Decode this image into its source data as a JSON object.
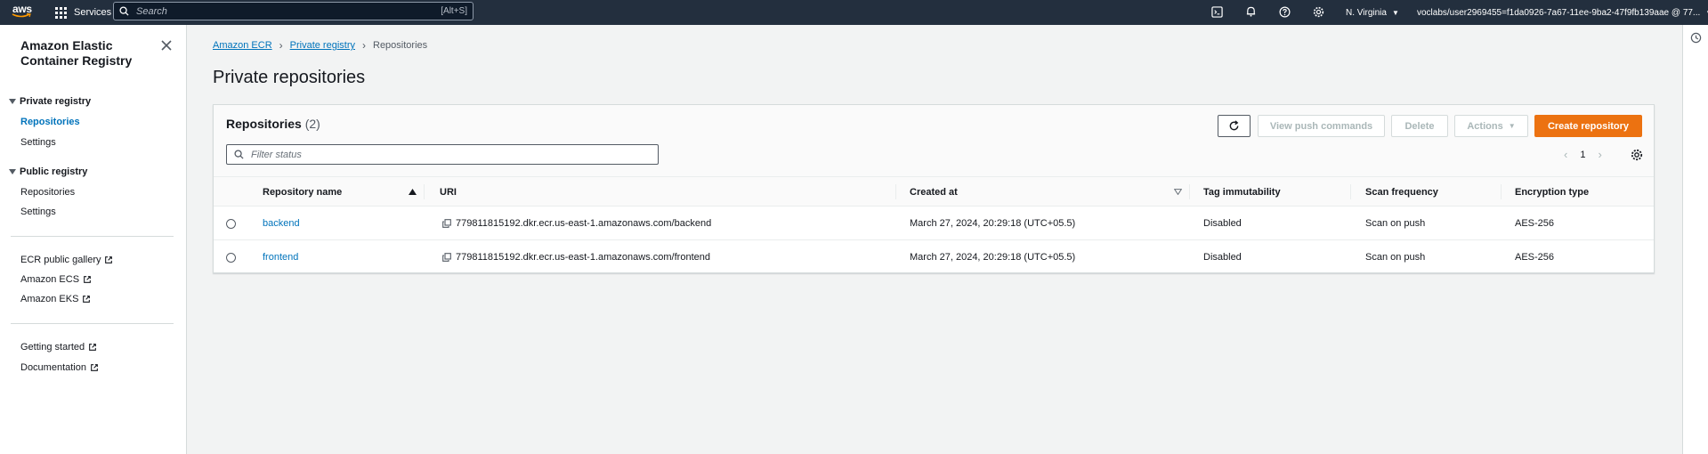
{
  "topnav": {
    "logo_text": "aws",
    "services_label": "Services",
    "search_placeholder": "Search",
    "search_shortcut": "[Alt+S]",
    "region": "N. Virginia",
    "account": "voclabs/user2969455=f1da0926-7a67-11ee-9ba2-47f9fb139aae @ 77..."
  },
  "sidebar": {
    "title": "Amazon Elastic Container Registry",
    "private_section": "Private registry",
    "private_items": [
      "Repositories",
      "Settings"
    ],
    "public_section": "Public registry",
    "public_items": [
      "Repositories",
      "Settings"
    ],
    "external_links": [
      "ECR public gallery",
      "Amazon ECS",
      "Amazon EKS"
    ],
    "help_links": [
      "Getting started",
      "Documentation"
    ]
  },
  "breadcrumb": [
    "Amazon ECR",
    "Private registry",
    "Repositories"
  ],
  "page_title": "Private repositories",
  "panel": {
    "title": "Repositories",
    "count": "(2)",
    "buttons": {
      "view_push": "View push commands",
      "delete": "Delete",
      "actions": "Actions",
      "create": "Create repository"
    },
    "filter_placeholder": "Filter status",
    "page_number": "1"
  },
  "table": {
    "columns": [
      "Repository name",
      "URI",
      "Created at",
      "Tag immutability",
      "Scan frequency",
      "Encryption type"
    ],
    "rows": [
      {
        "name": "backend",
        "uri": "779811815192.dkr.ecr.us-east-1.amazonaws.com/backend",
        "created": "March 27, 2024, 20:29:18 (UTC+05.5)",
        "tag_immutability": "Disabled",
        "scan_frequency": "Scan on push",
        "encryption": "AES-256"
      },
      {
        "name": "frontend",
        "uri": "779811815192.dkr.ecr.us-east-1.amazonaws.com/frontend",
        "created": "March 27, 2024, 20:29:18 (UTC+05.5)",
        "tag_immutability": "Disabled",
        "scan_frequency": "Scan on push",
        "encryption": "AES-256"
      }
    ]
  },
  "colors": {
    "nav_bg": "#232f3e",
    "link": "#0073bb",
    "primary_button": "#ec7211"
  }
}
